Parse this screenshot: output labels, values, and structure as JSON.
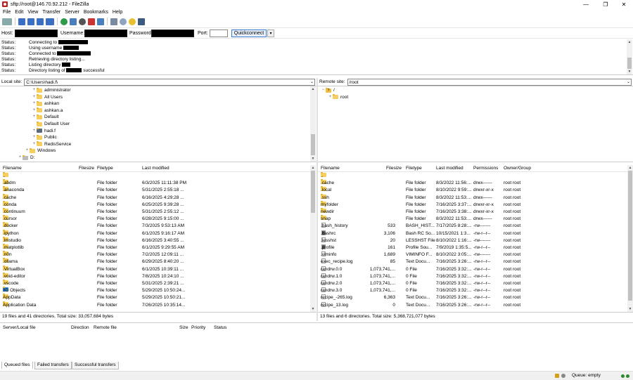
{
  "window": {
    "title": "sftp://root@146.70.92.212 - FileZilla",
    "min": "—",
    "max": "❐",
    "close": "✕"
  },
  "menu": [
    "File",
    "Edit",
    "View",
    "Transfer",
    "Server",
    "Bookmarks",
    "Help"
  ],
  "quickconnect": {
    "host_label": "Host:",
    "username_label": "Username:",
    "password_label": "Password:",
    "port_label": "Port:",
    "button": "Quickconnect",
    "dropdown": "▾"
  },
  "log": [
    {
      "status": "Status:",
      "text": "Connecting to",
      "after": ""
    },
    {
      "status": "Status:",
      "text": "Using username",
      "after": ""
    },
    {
      "status": "Status:",
      "text": "Connected to",
      "after": ""
    },
    {
      "status": "Status:",
      "text": "Retrieving directory listing...",
      "after": ""
    },
    {
      "status": "Status:",
      "text": "Listing directory",
      "after": ""
    },
    {
      "status": "Status:",
      "text": "Directory listing of",
      "after": "successful"
    }
  ],
  "local": {
    "site_label": "Local site:",
    "path": "C:\\Users\\hadi.f\\",
    "tree": [
      {
        "label": "administrator",
        "expand": "+",
        "type": "folder",
        "indent": 1
      },
      {
        "label": "All Users",
        "expand": "+",
        "type": "folder",
        "indent": 1
      },
      {
        "label": "ashkan",
        "expand": "+",
        "type": "folder",
        "indent": 1
      },
      {
        "label": "ashkan.a",
        "expand": "+",
        "type": "folder",
        "indent": 1
      },
      {
        "label": "Default",
        "expand": "+",
        "type": "folder",
        "indent": 1
      },
      {
        "label": "Default User",
        "expand": "",
        "type": "folder",
        "indent": 1
      },
      {
        "label": "hadi.f",
        "expand": "+",
        "type": "user",
        "indent": 1
      },
      {
        "label": "Public",
        "expand": "+",
        "type": "folder",
        "indent": 1
      },
      {
        "label": "RedisService",
        "expand": "+",
        "type": "folder",
        "indent": 1
      },
      {
        "label": "Windows",
        "expand": "+",
        "type": "folder",
        "indent": 0
      },
      {
        "label": "D:",
        "expand": "+",
        "type": "drive",
        "indent": -1
      }
    ],
    "columns": {
      "name": "Filename",
      "size": "Filesize",
      "type": "Filetype",
      "modified": "Last modified"
    },
    "files": [
      {
        "name": "..",
        "size": "",
        "type": "",
        "modified": "",
        "icon": "folder"
      },
      {
        "name": ".abdm",
        "size": "",
        "type": "File folder",
        "modified": "6/3/2025 11:11:38 PM",
        "icon": "folder"
      },
      {
        "name": ".anaconda",
        "size": "",
        "type": "File folder",
        "modified": "5/31/2025 2:55:18 ...",
        "icon": "folder"
      },
      {
        "name": ".cache",
        "size": "",
        "type": "File folder",
        "modified": "6/16/2025 4:29:28 ...",
        "icon": "folder"
      },
      {
        "name": ".conda",
        "size": "",
        "type": "File folder",
        "modified": "6/25/2025 9:39:28 ...",
        "icon": "folder"
      },
      {
        "name": ".continuum",
        "size": "",
        "type": "File folder",
        "modified": "5/31/2025 2:55:12 ...",
        "icon": "folder"
      },
      {
        "name": ".cursor",
        "size": "",
        "type": "File folder",
        "modified": "6/28/2025 9:15:00 ...",
        "icon": "folder"
      },
      {
        "name": ".docker",
        "size": "",
        "type": "File folder",
        "modified": "7/3/2025 9:53:13 AM",
        "icon": "folder"
      },
      {
        "name": ".ipython",
        "size": "",
        "type": "File folder",
        "modified": "6/1/2025 9:16:17 AM",
        "icon": "folder"
      },
      {
        "name": ".lmstudio",
        "size": "",
        "type": "File folder",
        "modified": "6/16/2025 3:40:55 ...",
        "icon": "folder"
      },
      {
        "name": ".matplotlib",
        "size": "",
        "type": "File folder",
        "modified": "6/1/2025 9:29:55 AM",
        "icon": "folder"
      },
      {
        "name": ".n0n",
        "size": "",
        "type": "File folder",
        "modified": "7/2/2025 12:09:11 ...",
        "icon": "folder"
      },
      {
        "name": ".ollama",
        "size": "",
        "type": "File folder",
        "modified": "6/29/2025 8:40:20 ...",
        "icon": "folder"
      },
      {
        "name": ".VirtualBox",
        "size": "",
        "type": "File folder",
        "modified": "6/1/2025 10:39:11 ...",
        "icon": "folder"
      },
      {
        "name": ".void-editor",
        "size": "",
        "type": "File folder",
        "modified": "7/8/2025 10:24:10 ...",
        "icon": "folder"
      },
      {
        "name": ".vscode",
        "size": "",
        "type": "File folder",
        "modified": "5/31/2025 2:39:21 ...",
        "icon": "folder"
      },
      {
        "name": "3D Objects",
        "size": "",
        "type": "File folder",
        "modified": "5/29/2025 10:50:24...",
        "icon": "obj3d"
      },
      {
        "name": "AppData",
        "size": "",
        "type": "File folder",
        "modified": "5/29/2025 10:50:21...",
        "icon": "folder"
      },
      {
        "name": "Application Data",
        "size": "",
        "type": "File folder",
        "modified": "7/26/2025 10:35:14...",
        "icon": "folder"
      }
    ],
    "status": "19 files and 41 directories. Total size: 33,057,684 bytes"
  },
  "remote": {
    "site_label": "Remote site:",
    "path": "/root",
    "tree": [
      {
        "label": "/",
        "expand": "−",
        "type": "unknown",
        "indent": 0
      },
      {
        "label": "root",
        "expand": "+",
        "type": "folder",
        "indent": 1
      }
    ],
    "columns": {
      "name": "Filename",
      "size": "Filesize",
      "type": "Filetype",
      "modified": "Last modified",
      "perms": "Permissions",
      "owner": "Owner/Group"
    },
    "files": [
      {
        "name": "..",
        "size": "",
        "type": "",
        "modified": "",
        "perms": "",
        "owner": "",
        "icon": "folder"
      },
      {
        "name": ".cache",
        "size": "",
        "type": "File folder",
        "modified": "8/3/2022 11:56:...",
        "perms": "drwx------",
        "owner": "root root",
        "icon": "folder"
      },
      {
        "name": ".local",
        "size": "",
        "type": "File folder",
        "modified": "8/10/2022 9:59:...",
        "perms": "drwxr-xr-x",
        "owner": "root root",
        "icon": "folder"
      },
      {
        "name": ".ssh",
        "size": "",
        "type": "File folder",
        "modified": "8/3/2022 11:53:...",
        "perms": "drwx------",
        "owner": "root root",
        "icon": "folder"
      },
      {
        "name": "myfolder",
        "size": "",
        "type": "File folder",
        "modified": "7/16/2025 3:37:...",
        "perms": "drwxr-xr-x",
        "owner": "root root",
        "icon": "folder"
      },
      {
        "name": "newdir",
        "size": "",
        "type": "File folder",
        "modified": "7/16/2025 3:38:...",
        "perms": "drwxr-xr-x",
        "owner": "root root",
        "icon": "folder"
      },
      {
        "name": "snap",
        "size": "",
        "type": "File folder",
        "modified": "8/3/2022 11:53:...",
        "perms": "drwx------",
        "owner": "root root",
        "icon": "folder"
      },
      {
        "name": ".bash_history",
        "size": "533",
        "type": "BASH_HIST...",
        "modified": "7/17/2025 8:28:...",
        "perms": "-rw-------",
        "owner": "root root",
        "icon": "file"
      },
      {
        "name": ".bashrc",
        "size": "3,106",
        "type": "Bash RC So...",
        "modified": "10/15/2021 1:3...",
        "perms": "-rw-r--r--",
        "owner": "root root",
        "icon": "script"
      },
      {
        "name": ".lesshst",
        "size": "20",
        "type": "LESSHST File",
        "modified": "8/10/2022 1:16:...",
        "perms": "-rw-------",
        "owner": "root root",
        "icon": "file"
      },
      {
        "name": ".profile",
        "size": "161",
        "type": "Profile Sou...",
        "modified": "7/9/2019 1:35:5...",
        "perms": "-rw-r--r--",
        "owner": "root root",
        "icon": "script"
      },
      {
        "name": ".viminfo",
        "size": "1,689",
        "type": "VIMINFO F...",
        "modified": "8/10/2022 3:05:...",
        "perms": "-rw-------",
        "owner": "root root",
        "icon": "file"
      },
      {
        "name": "exec_recipe.log",
        "size": "85",
        "type": "Text Docu...",
        "modified": "7/16/2025 3:26:...",
        "perms": "-rw-r--r--",
        "owner": "root root",
        "icon": "file"
      },
      {
        "name": "randrw.0.0",
        "size": "1,073,741,...",
        "type": "0 File",
        "modified": "7/16/2025 3:32:...",
        "perms": "-rw-r--r--",
        "owner": "root root",
        "icon": "file"
      },
      {
        "name": "randrw.1.0",
        "size": "1,073,741,...",
        "type": "0 File",
        "modified": "7/16/2025 3:32:...",
        "perms": "-rw-r--r--",
        "owner": "root root",
        "icon": "file"
      },
      {
        "name": "randrw.2.0",
        "size": "1,073,741,...",
        "type": "0 File",
        "modified": "7/16/2025 3:32:...",
        "perms": "-rw-r--r--",
        "owner": "root root",
        "icon": "file"
      },
      {
        "name": "randrw.3.0",
        "size": "1,073,741,...",
        "type": "0 File",
        "modified": "7/16/2025 3:32:...",
        "perms": "-rw-r--r--",
        "owner": "root root",
        "icon": "file"
      },
      {
        "name": "recipe_-265.log",
        "size": "6,363",
        "type": "Text Docu...",
        "modified": "7/16/2025 3:26:...",
        "perms": "-rw-r--r--",
        "owner": "root root",
        "icon": "file"
      },
      {
        "name": "recipe_13.log",
        "size": "0",
        "type": "Text Docu...",
        "modified": "7/16/2025 3:26:...",
        "perms": "-rw-r--r--",
        "owner": "root root",
        "icon": "file"
      }
    ],
    "status": "13 files and 6 directories. Total size: 5,368,721,077 bytes"
  },
  "queue": {
    "columns": [
      "Server/Local file",
      "Direction",
      "Remote file",
      "Size",
      "Priority",
      "Status"
    ]
  },
  "tabs": [
    "Queued files",
    "Failed transfers",
    "Successful transfers"
  ],
  "statusbar": {
    "queue": "Queue: empty"
  }
}
